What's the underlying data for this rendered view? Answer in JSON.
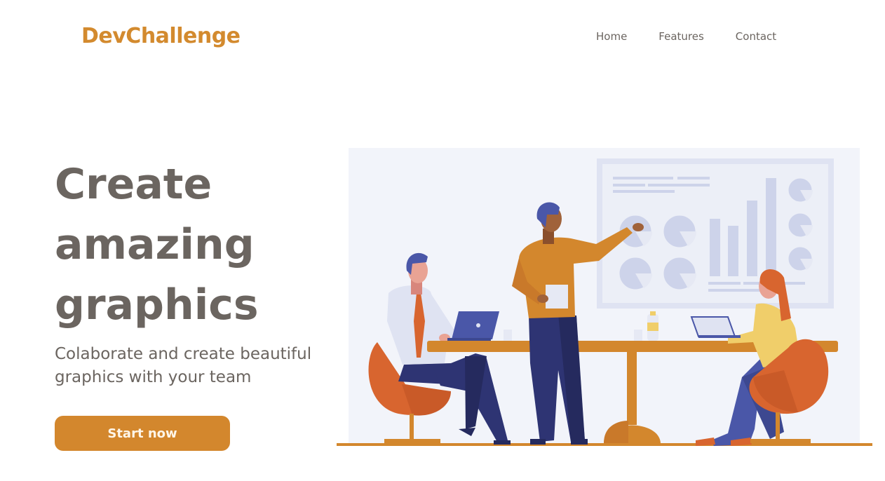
{
  "header": {
    "logo": "DevChallenge",
    "nav": [
      "Home",
      "Features",
      "Contact"
    ]
  },
  "hero": {
    "title_lines": [
      "Create",
      "amazing",
      "graphics"
    ],
    "subtitle": "Colaborate and create beautiful graphics with your team",
    "cta_label": "Start now"
  },
  "illustration": {
    "icon": "team-meeting-illustration",
    "colors": {
      "accent": "#d3872d",
      "navy": "#2e3473",
      "background": "#f2f4fa",
      "board": "#dfe3f2"
    }
  }
}
